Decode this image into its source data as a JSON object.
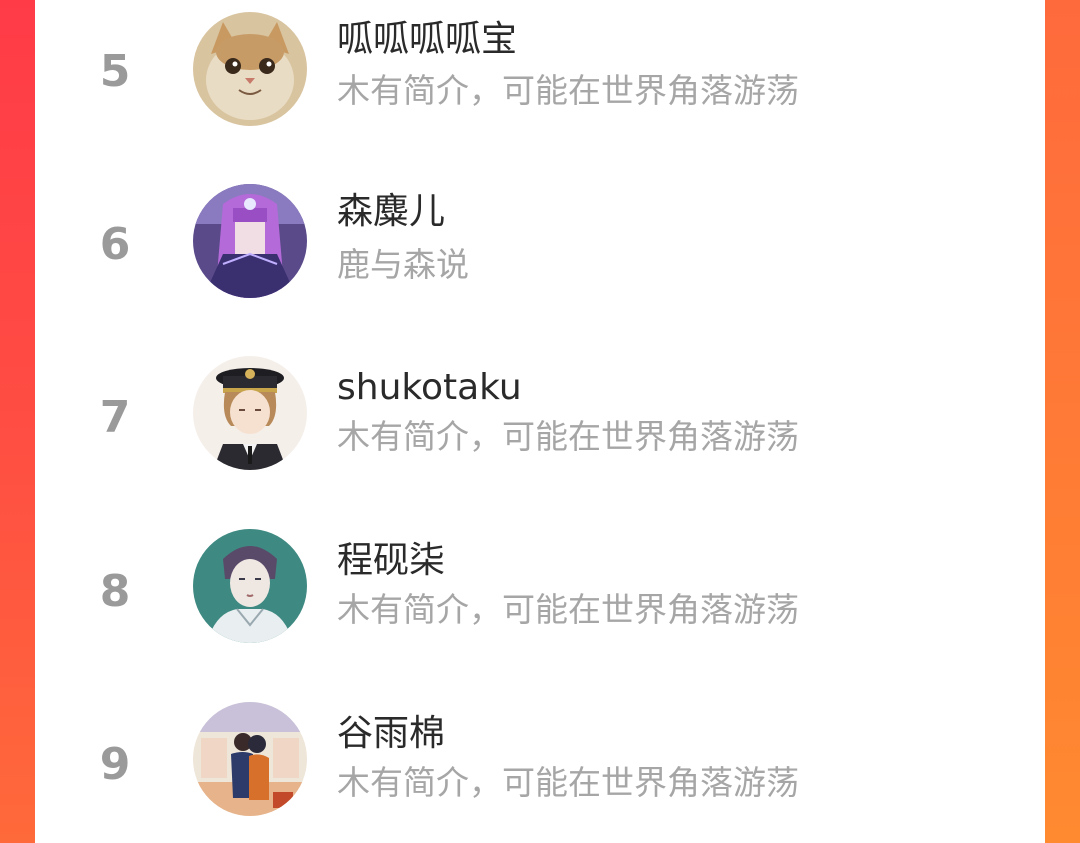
{
  "ranking": {
    "rows": [
      {
        "rank": "5",
        "name": "呱呱呱呱宝",
        "bio": "木有简介，可能在世界角落游荡",
        "avatar": "cat-avatar"
      },
      {
        "rank": "6",
        "name": "森麋儿",
        "bio": "鹿与森说",
        "avatar": "purple-hair-girl-avatar"
      },
      {
        "rank": "7",
        "name": "shukotaku",
        "bio": "木有简介，可能在世界角落游荡",
        "avatar": "captain-hat-boy-avatar"
      },
      {
        "rank": "8",
        "name": "程砚柒",
        "bio": "木有简介，可能在世界角落游荡",
        "avatar": "sketch-man-avatar"
      },
      {
        "rank": "9",
        "name": "谷雨棉",
        "bio": "木有简介，可能在世界角落游荡",
        "avatar": "hugging-couple-avatar"
      }
    ]
  },
  "colors": {
    "accent_gradient_top": "#ff3d45",
    "accent_gradient_bottom": "#ff7a34",
    "rank_color": "#9a9a9a",
    "name_color": "#2a2a2a",
    "bio_color": "#a6a6a6"
  }
}
